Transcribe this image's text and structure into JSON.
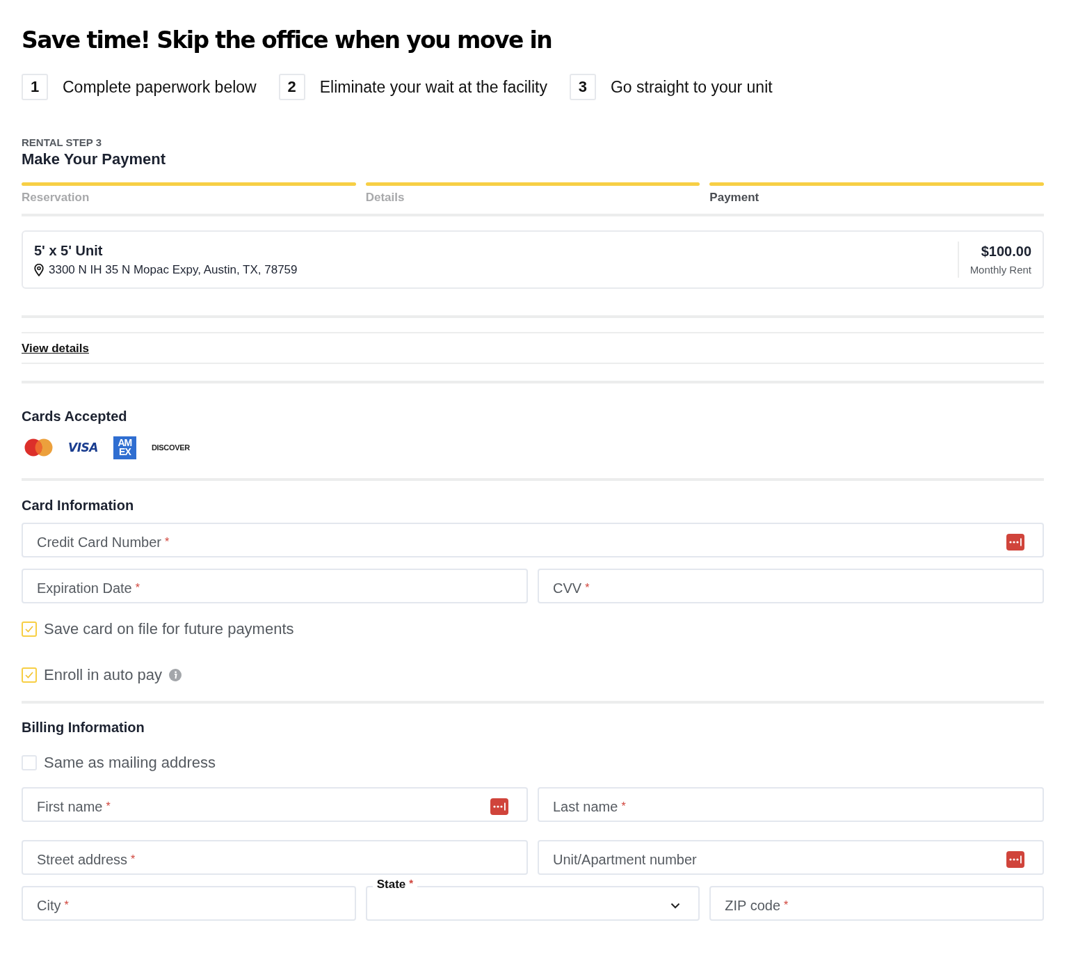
{
  "heading": "Save time! Skip the office when you move in",
  "benefits": [
    {
      "number": "1",
      "text": "Complete paperwork below"
    },
    {
      "number": "2",
      "text": "Eliminate your wait at the facility"
    },
    {
      "number": "3",
      "text": "Go straight to your unit"
    }
  ],
  "step_label": "RENTAL STEP 3",
  "step_title": "Make Your Payment",
  "progress": [
    {
      "label": "Reservation",
      "complete": true,
      "selected": false
    },
    {
      "label": "Details",
      "complete": true,
      "selected": false
    },
    {
      "label": "Payment",
      "complete": true,
      "selected": true
    }
  ],
  "unit": {
    "name": "5' x 5' Unit",
    "address": "3300 N IH 35 N Mopac Expy, Austin, TX, 78759",
    "price": "$100.00",
    "price_note": "Monthly Rent"
  },
  "view_details": "View details",
  "cards_title": "Cards Accepted",
  "cards": [
    {
      "kind": "mastercard"
    },
    {
      "kind": "visa",
      "text": "VISA"
    },
    {
      "kind": "amex",
      "text": "AM",
      "text2": "EX"
    },
    {
      "kind": "discover",
      "text": "DISCOVER"
    }
  ],
  "card_info_title": "Card Information",
  "card_fields": [
    [
      {
        "label": "Credit Card Number",
        "required": "*",
        "manager_icon": true
      }
    ],
    [
      {
        "label": "Expiration Date",
        "required": "*",
        "manager_icon": false
      },
      {
        "label": "CVV",
        "required": "*",
        "manager_icon": false
      }
    ]
  ],
  "options": [
    {
      "label": "Save card on file for future payments",
      "checked": true,
      "info": false
    },
    {
      "label": "Enroll in auto pay",
      "checked": true,
      "info": true
    }
  ],
  "billing_title": "Billing Information",
  "same_as_mailing": {
    "label": "Same as mailing address",
    "checked": false,
    "info": false
  },
  "billing_fields": [
    [
      {
        "label": "First name",
        "required": "*",
        "manager_icon": true
      },
      {
        "label": "Last name",
        "required": "*",
        "manager_icon": false
      }
    ],
    [
      {
        "label": "Street address",
        "required": "*",
        "manager_icon": false
      },
      {
        "label": "Unit/Apartment number",
        "manager_icon": true
      }
    ],
    [
      {
        "label": "City",
        "required": "*",
        "manager_icon": false
      },
      {
        "kind": "select",
        "label": "State",
        "required": "*"
      },
      {
        "label": "ZIP code",
        "required": "*",
        "manager_icon": false
      }
    ]
  ]
}
